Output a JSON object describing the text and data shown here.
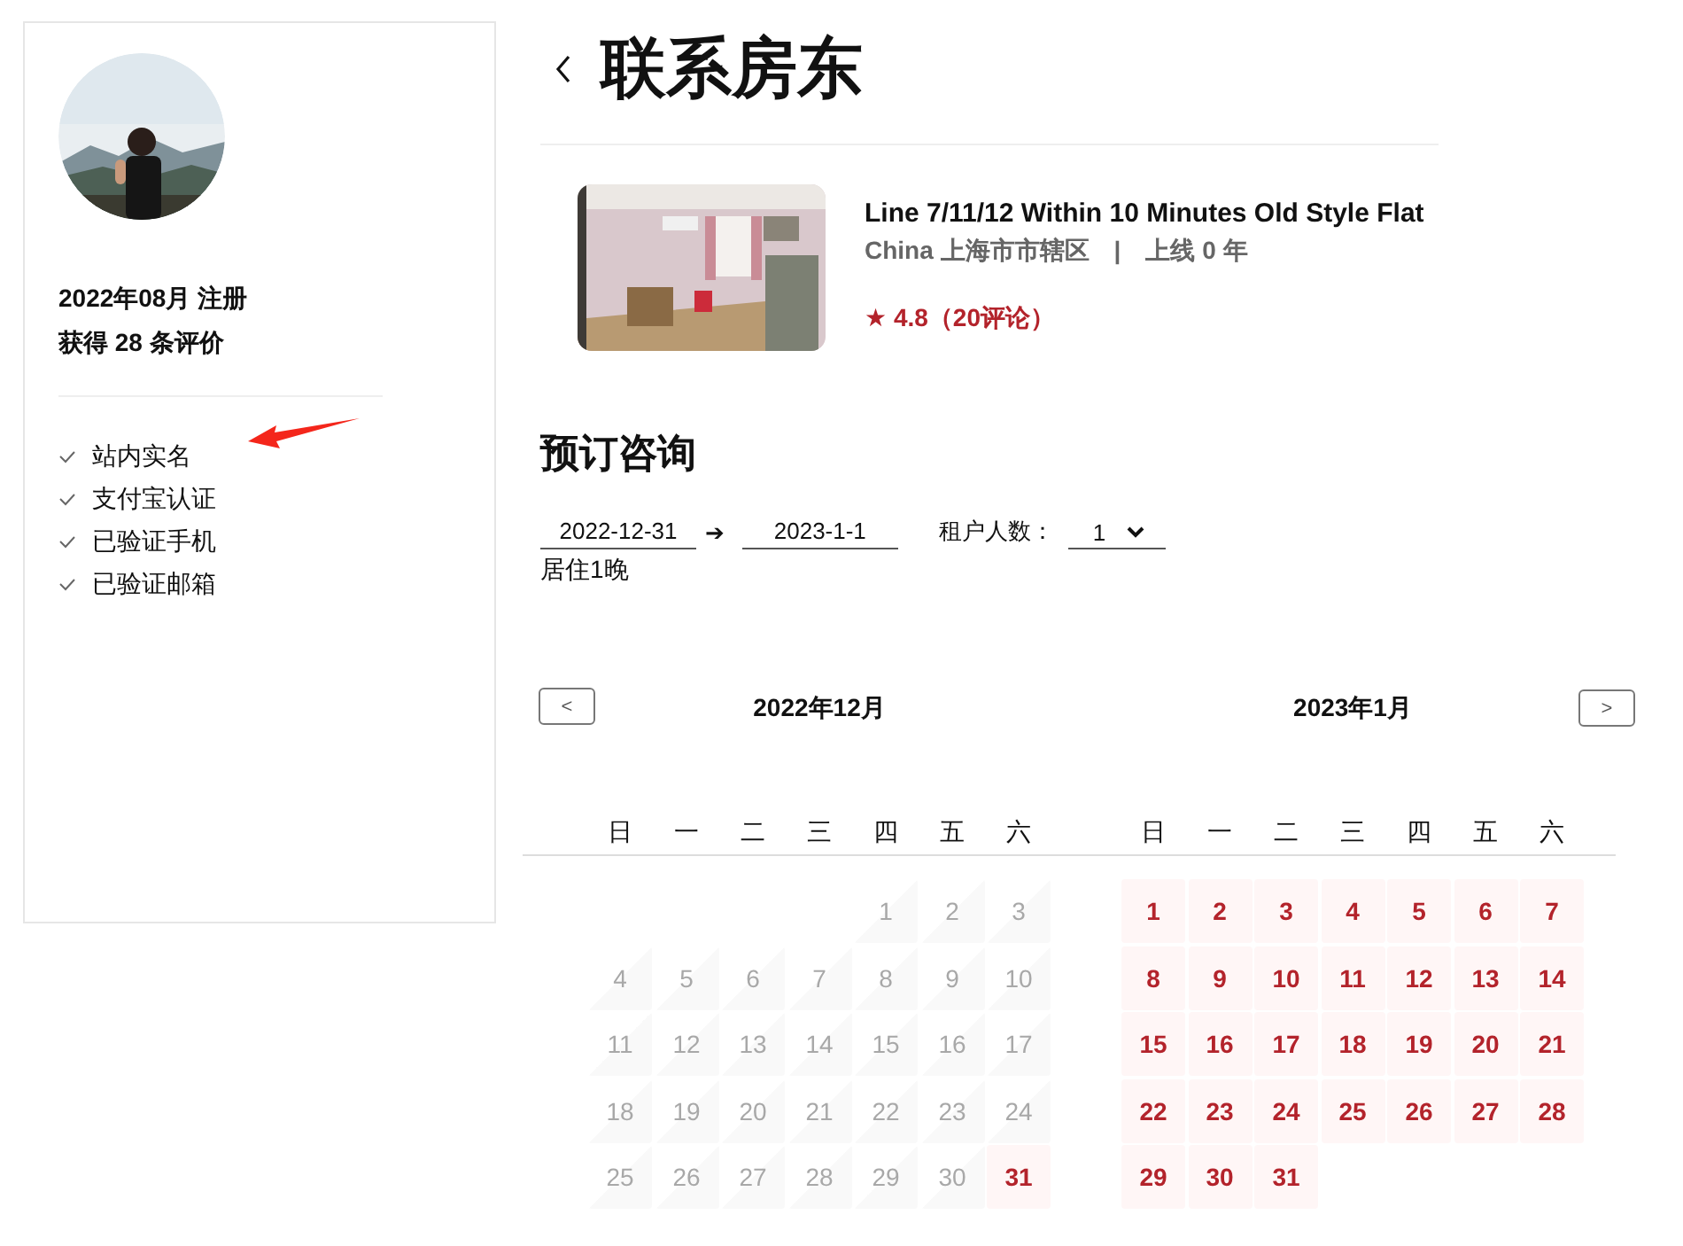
{
  "page": {
    "title": "联系房东"
  },
  "host": {
    "registered": "2022年08月 注册",
    "reviews": "获得 28 条评价",
    "verifications": [
      {
        "label": "站内实名",
        "checked": true
      },
      {
        "label": "支付宝认证",
        "checked": true
      },
      {
        "label": "已验证手机",
        "checked": true
      },
      {
        "label": "已验证邮箱",
        "checked": true
      }
    ]
  },
  "listing": {
    "title": "Line 7/11/12 Within 10 Minutes Old Style Flat",
    "location": "China 上海市市辖区",
    "separator": "|",
    "online": "上线 0 年",
    "rating": "★ 4.8（20评论）"
  },
  "booking": {
    "heading": "预订咨询",
    "check_in": "2022-12-31",
    "arrow": "➔",
    "check_out": "2023-1-1",
    "guests_label": "租户人数：",
    "guests": "1",
    "nights": "居住1晚"
  },
  "calendar": {
    "prev": "<",
    "next": ">",
    "months": [
      {
        "title": "2022年12月",
        "weekdays": [
          "日",
          "一",
          "二",
          "三",
          "四",
          "五",
          "六"
        ],
        "days": [
          {
            "kind": "blank"
          },
          {
            "kind": "blank"
          },
          {
            "kind": "blank"
          },
          {
            "kind": "blank"
          },
          {
            "kind": "day",
            "label": "1",
            "disabled": true
          },
          {
            "kind": "day",
            "label": "2",
            "disabled": true
          },
          {
            "kind": "day",
            "label": "3",
            "disabled": true
          },
          {
            "kind": "day",
            "label": "4",
            "disabled": true
          },
          {
            "kind": "day",
            "label": "5",
            "disabled": true
          },
          {
            "kind": "day",
            "label": "6",
            "disabled": true
          },
          {
            "kind": "day",
            "label": "7",
            "disabled": true
          },
          {
            "kind": "day",
            "label": "8",
            "disabled": true
          },
          {
            "kind": "day",
            "label": "9",
            "disabled": true
          },
          {
            "kind": "day",
            "label": "10",
            "disabled": true
          },
          {
            "kind": "day",
            "label": "11",
            "disabled": true
          },
          {
            "kind": "day",
            "label": "12",
            "disabled": true
          },
          {
            "kind": "day",
            "label": "13",
            "disabled": true
          },
          {
            "kind": "day",
            "label": "14",
            "disabled": true
          },
          {
            "kind": "day",
            "label": "15",
            "disabled": true
          },
          {
            "kind": "day",
            "label": "16",
            "disabled": true
          },
          {
            "kind": "day",
            "label": "17",
            "disabled": true
          },
          {
            "kind": "day",
            "label": "18",
            "disabled": true
          },
          {
            "kind": "day",
            "label": "19",
            "disabled": true
          },
          {
            "kind": "day",
            "label": "20",
            "disabled": true
          },
          {
            "kind": "day",
            "label": "21",
            "disabled": true
          },
          {
            "kind": "day",
            "label": "22",
            "disabled": true
          },
          {
            "kind": "day",
            "label": "23",
            "disabled": true
          },
          {
            "kind": "day",
            "label": "24",
            "disabled": true
          },
          {
            "kind": "day",
            "label": "25",
            "disabled": true
          },
          {
            "kind": "day",
            "label": "26",
            "disabled": true
          },
          {
            "kind": "day",
            "label": "27",
            "disabled": true
          },
          {
            "kind": "day",
            "label": "28",
            "disabled": true
          },
          {
            "kind": "day",
            "label": "29",
            "disabled": true
          },
          {
            "kind": "day",
            "label": "30",
            "disabled": true
          },
          {
            "kind": "day",
            "label": "31",
            "disabled": false
          }
        ]
      },
      {
        "title": "2023年1月",
        "weekdays": [
          "日",
          "一",
          "二",
          "三",
          "四",
          "五",
          "六"
        ],
        "days": [
          {
            "kind": "day",
            "label": "1",
            "disabled": false
          },
          {
            "kind": "day",
            "label": "2",
            "disabled": false
          },
          {
            "kind": "day",
            "label": "3",
            "disabled": false
          },
          {
            "kind": "day",
            "label": "4",
            "disabled": false
          },
          {
            "kind": "day",
            "label": "5",
            "disabled": false
          },
          {
            "kind": "day",
            "label": "6",
            "disabled": false
          },
          {
            "kind": "day",
            "label": "7",
            "disabled": false
          },
          {
            "kind": "day",
            "label": "8",
            "disabled": false
          },
          {
            "kind": "day",
            "label": "9",
            "disabled": false
          },
          {
            "kind": "day",
            "label": "10",
            "disabled": false
          },
          {
            "kind": "day",
            "label": "11",
            "disabled": false
          },
          {
            "kind": "day",
            "label": "12",
            "disabled": false
          },
          {
            "kind": "day",
            "label": "13",
            "disabled": false
          },
          {
            "kind": "day",
            "label": "14",
            "disabled": false
          },
          {
            "kind": "day",
            "label": "15",
            "disabled": false
          },
          {
            "kind": "day",
            "label": "16",
            "disabled": false
          },
          {
            "kind": "day",
            "label": "17",
            "disabled": false
          },
          {
            "kind": "day",
            "label": "18",
            "disabled": false
          },
          {
            "kind": "day",
            "label": "19",
            "disabled": false
          },
          {
            "kind": "day",
            "label": "20",
            "disabled": false
          },
          {
            "kind": "day",
            "label": "21",
            "disabled": false
          },
          {
            "kind": "day",
            "label": "22",
            "disabled": false
          },
          {
            "kind": "day",
            "label": "23",
            "disabled": false
          },
          {
            "kind": "day",
            "label": "24",
            "disabled": false
          },
          {
            "kind": "day",
            "label": "25",
            "disabled": false
          },
          {
            "kind": "day",
            "label": "26",
            "disabled": false
          },
          {
            "kind": "day",
            "label": "27",
            "disabled": false
          },
          {
            "kind": "day",
            "label": "28",
            "disabled": false
          },
          {
            "kind": "day",
            "label": "29",
            "disabled": false
          },
          {
            "kind": "day",
            "label": "30",
            "disabled": false
          },
          {
            "kind": "day",
            "label": "31",
            "disabled": false
          }
        ]
      }
    ]
  }
}
